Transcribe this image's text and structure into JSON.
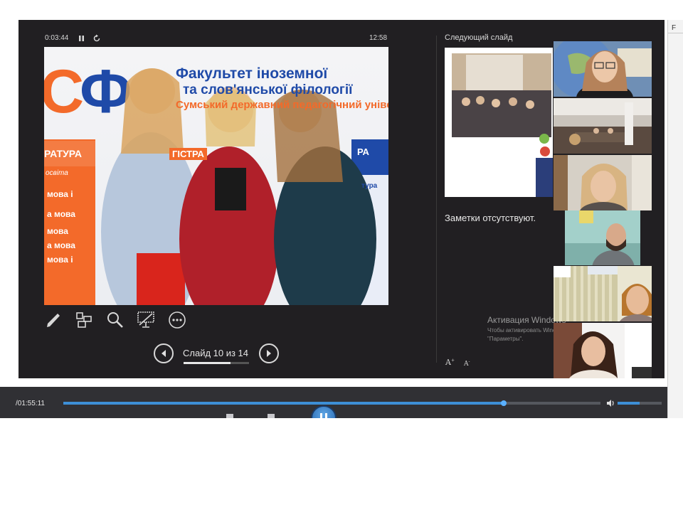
{
  "presenter": {
    "elapsed_time": "0:03:44",
    "clock": "12:58",
    "slide_counter": "Слайд 10 из 14",
    "slide_progress_fraction": 0.72,
    "next_slide_label": "Следующий слайд",
    "notes_text": "Заметки отсутствуют.",
    "font_increase_label": "A",
    "font_decrease_label": "A"
  },
  "slide": {
    "title_line1": "Факультет іноземної",
    "title_line2": "та слов'янської філології",
    "title_line3": "Сумський державний педагогічний університет імені А. С. Макаренка",
    "logo_text": "СФ",
    "banner_left_heading": "РАТУРА",
    "banner_left_sub": "освіта",
    "banner_left_items": [
      "мова і",
      "а мова",
      "мова",
      "а мова",
      "мова і"
    ],
    "banner_mid_heading": "ГІСТРА",
    "banner_right_heading": "РА",
    "banner_right_sub": "тура"
  },
  "windows_activation": {
    "title": "Активация Windows",
    "line1": "Чтобы активировать Windows, перейдите в раздел",
    "line2": "\"Параметры\"."
  },
  "player": {
    "time": "/01:55:11",
    "seek_fraction": 0.82,
    "volume_fraction": 0.5
  },
  "right_panel_letter": "F",
  "colors": {
    "accent": "#3d8fd6",
    "slide_orange": "#f36a2a",
    "slide_blue": "#1f4aa8"
  }
}
